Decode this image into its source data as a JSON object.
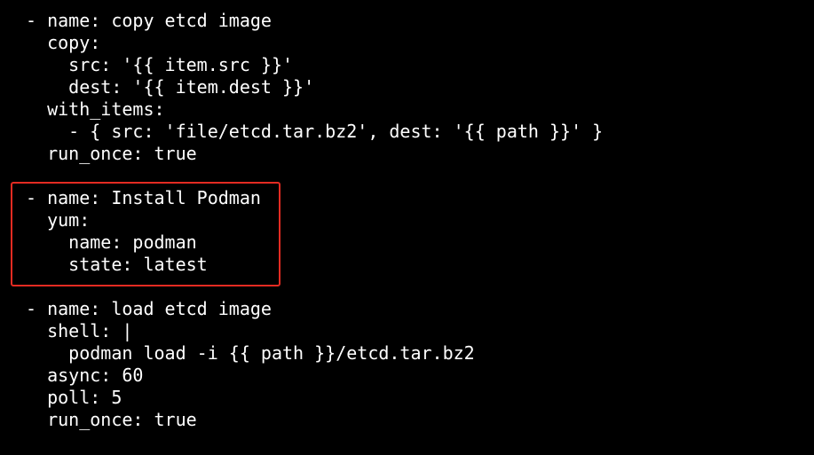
{
  "editor": {
    "lines": [
      "- name: copy etcd image",
      "  copy:",
      "    src: '{{ item.src }}'",
      "    dest: '{{ item.dest }}'",
      "  with_items:",
      "    - { src: 'file/etcd.tar.bz2', dest: '{{ path }}' }",
      "  run_once: true",
      "",
      "- name: Install Podman",
      "  yum:",
      "    name: podman",
      "    state: latest",
      "",
      "- name: load etcd image",
      "  shell: |",
      "    podman load -i {{ path }}/etcd.tar.bz2",
      "  async: 60",
      "  poll: 5",
      "  run_once: true"
    ]
  },
  "colors": {
    "background": "#000000",
    "text": "#ffffff",
    "highlight_border": "#e32b22"
  }
}
